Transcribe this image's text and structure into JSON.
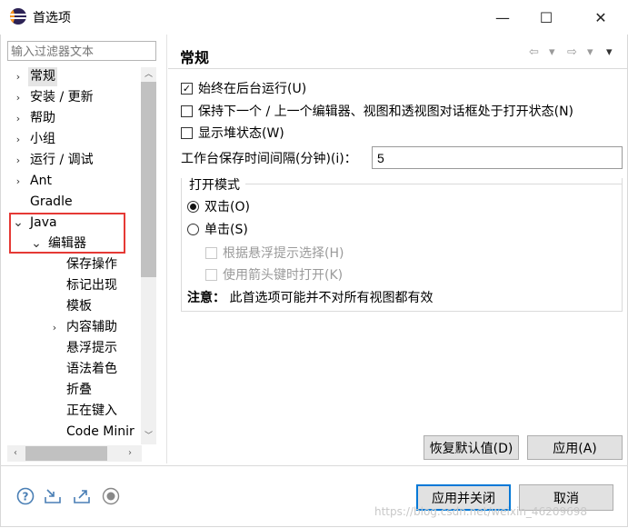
{
  "window": {
    "title": "首选项",
    "minimize": "—",
    "maximize": "☐",
    "close": "✕"
  },
  "sidebar": {
    "filter_placeholder": "输入过滤器文本",
    "tree": [
      {
        "label": "常规",
        "expander": "›",
        "selected": true
      },
      {
        "label": "安装 / 更新",
        "expander": "›"
      },
      {
        "label": "帮助",
        "expander": "›"
      },
      {
        "label": "小组",
        "expander": "›"
      },
      {
        "label": "运行 / 调试",
        "expander": "›"
      },
      {
        "label": "Ant",
        "expander": "›"
      },
      {
        "label": "Gradle",
        "expander": ""
      },
      {
        "label": "Java",
        "expander": "⌄"
      },
      {
        "label": "编辑器",
        "expander": "⌄"
      },
      {
        "label": "保存操作",
        "expander": ""
      },
      {
        "label": "标记出现",
        "expander": ""
      },
      {
        "label": "模板",
        "expander": ""
      },
      {
        "label": "内容辅助",
        "expander": "›"
      },
      {
        "label": "悬浮提示",
        "expander": ""
      },
      {
        "label": "语法着色",
        "expander": ""
      },
      {
        "label": "折叠",
        "expander": ""
      },
      {
        "label": "正在键入",
        "expander": ""
      },
      {
        "label": "Code Minir",
        "expander": ""
      }
    ]
  },
  "main": {
    "page_title": "常规",
    "nav": {
      "back": "⇦",
      "back_menu": "▾",
      "forward": "⇨",
      "forward_menu": "▾",
      "view_menu": "▾"
    },
    "options": [
      {
        "label": "始终在后台运行(U)",
        "checked": true,
        "mark": "✓"
      },
      {
        "label": "保持下一个 / 上一个编辑器、视图和透视图对话框处于打开状态(N)",
        "checked": false,
        "mark": ""
      },
      {
        "label": "显示堆状态(W)",
        "checked": false,
        "mark": ""
      }
    ],
    "interval_label": "工作台保存时间间隔(分钟)(i)：",
    "interval_value": "5",
    "open_mode": {
      "title": "打开模式",
      "double_click": "双击(O)",
      "single_click": "单击(S)",
      "hover_select": "根据悬浮提示选择(H)",
      "arrow_open": "使用箭头键时打开(K)"
    },
    "note_label": "注意：",
    "note_text": " 此首选项可能并不对所有视图都有效",
    "restore_defaults": "恢复默认值(D)",
    "apply": "应用(A)"
  },
  "footer": {
    "apply_close": "应用并关闭",
    "cancel": "取消",
    "watermark": "https://blog.csdn.net/weixin_46209698"
  },
  "colors": {
    "highlight_box": "#e53935",
    "default_button_border": "#0078d7",
    "selected_row": "#e5e5e5"
  }
}
